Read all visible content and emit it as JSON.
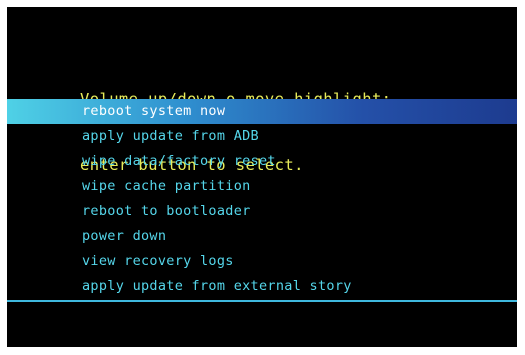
{
  "header": {
    "line1": "Volume up/down o move highlight;",
    "line2": "enter button to select."
  },
  "menu": {
    "items": [
      {
        "label": "reboot system now",
        "selected": true
      },
      {
        "label": "apply update from ADB",
        "selected": false
      },
      {
        "label": "wipe data/factory reset",
        "selected": false
      },
      {
        "label": "wipe cache partition",
        "selected": false
      },
      {
        "label": "reboot to bootloader",
        "selected": false
      },
      {
        "label": "power down",
        "selected": false
      },
      {
        "label": "view recovery logs",
        "selected": false
      },
      {
        "label": "apply update from external story",
        "selected": false
      }
    ]
  },
  "colors": {
    "background": "#000000",
    "header_text": "#e8ec5a",
    "menu_text": "#55d6ea",
    "highlight_start": "#4fd1e6",
    "highlight_end": "#1d3b8f",
    "divider": "#3fb8de"
  }
}
